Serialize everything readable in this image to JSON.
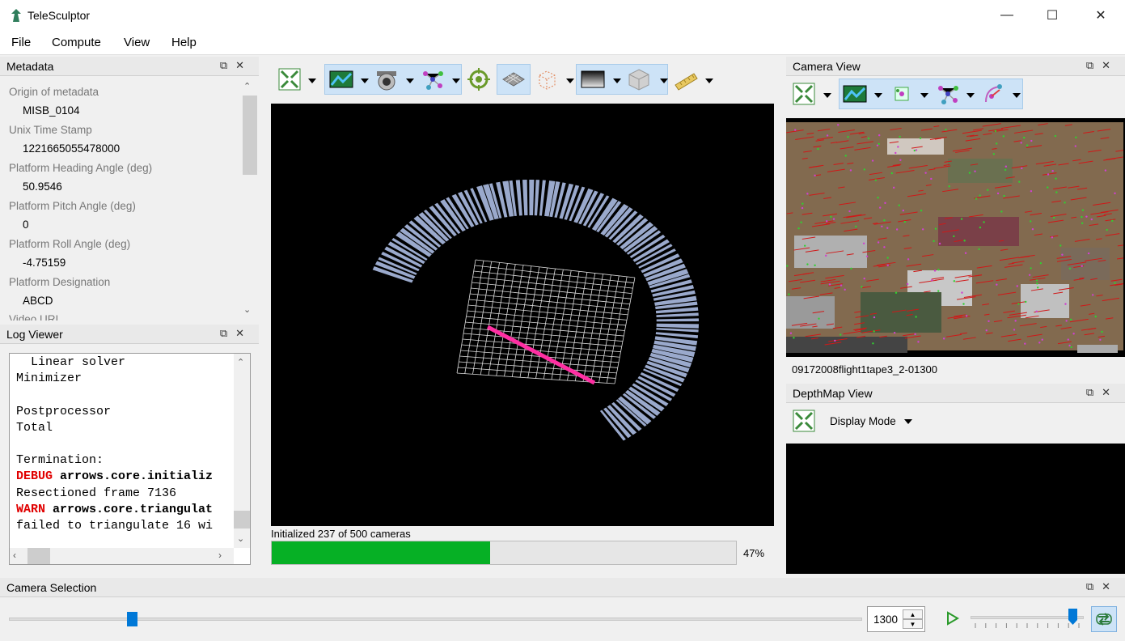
{
  "window": {
    "title": "TeleSculptor",
    "minimize": "—",
    "maximize": "☐",
    "close": "✕"
  },
  "menu": [
    "File",
    "Compute",
    "View",
    "Help"
  ],
  "metadata_panel": {
    "title": "Metadata",
    "items": [
      {
        "key": "Origin of metadata",
        "value": "MISB_0104"
      },
      {
        "key": "Unix Time Stamp",
        "value": "1221665055478000"
      },
      {
        "key": "Platform Heading Angle (deg)",
        "value": "50.9546"
      },
      {
        "key": "Platform Pitch Angle (deg)",
        "value": "0"
      },
      {
        "key": "Platform Roll Angle (deg)",
        "value": "-4.75159"
      },
      {
        "key": "Platform Designation",
        "value": "ABCD"
      }
    ],
    "cut_off_item": "Video URI"
  },
  "log_panel": {
    "title": "Log Viewer",
    "lines": [
      {
        "prefix": "",
        "text": "  Linear solver"
      },
      {
        "prefix": "",
        "text": "Minimizer"
      },
      {
        "prefix": "",
        "text": ""
      },
      {
        "prefix": "",
        "text": "Postprocessor"
      },
      {
        "prefix": "",
        "text": "Total"
      },
      {
        "prefix": "",
        "text": ""
      },
      {
        "prefix": "",
        "text": "Termination:"
      },
      {
        "prefix": "DEBUG",
        "text": " arrows.core.initializ"
      },
      {
        "prefix": "",
        "text": "Resectioned frame 7136"
      },
      {
        "prefix": "WARN",
        "text": " arrows.core.triangulat"
      },
      {
        "prefix": "",
        "text": "failed to triangulate 16 wi"
      }
    ]
  },
  "progress": {
    "label": "Initialized 237 of 500 cameras",
    "percent_text": "47%",
    "fraction": 0.47
  },
  "camera_view": {
    "title": "Camera View",
    "frame_name": "09172008flight1tape3_2-01300"
  },
  "depthmap_view": {
    "title": "DepthMap View",
    "display_mode_label": "Display Mode"
  },
  "camera_selection": {
    "title": "Camera Selection",
    "frame_value": "1300",
    "slider_fraction": 0.144,
    "speed_fraction": 0.9
  },
  "colors": {
    "progress_fill": "#06b025",
    "debug": "#e00000",
    "accent_blue": "#0078d7",
    "camera_frustum": "#9aa9cc",
    "path_magenta": "#ff2fa3"
  }
}
